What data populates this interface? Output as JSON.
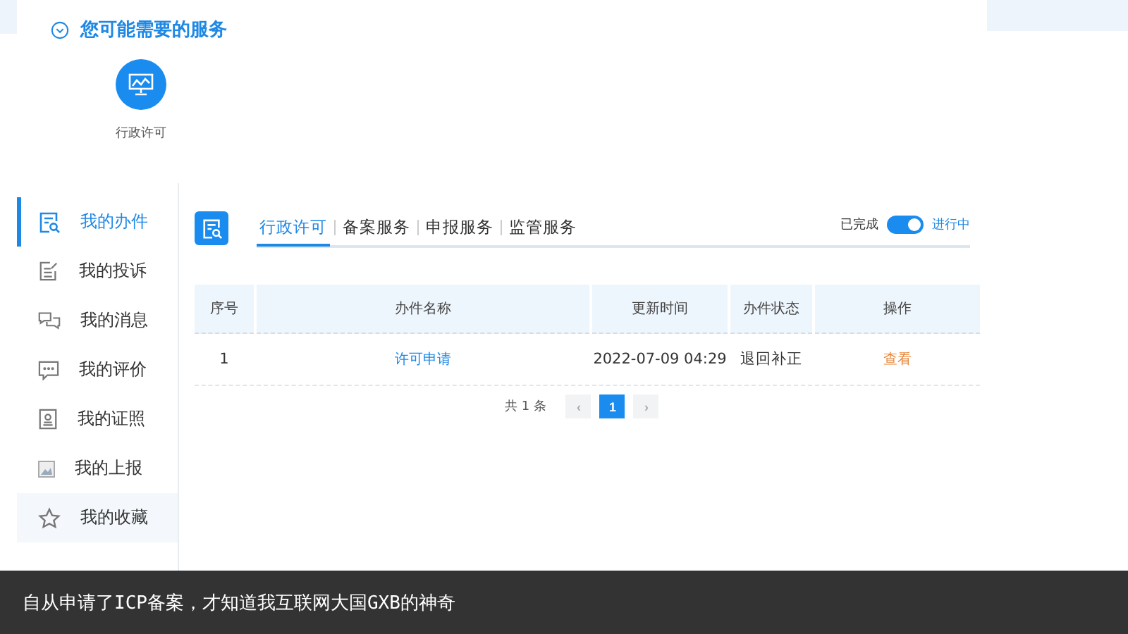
{
  "services": {
    "title": "您可能需要的服务",
    "items": [
      {
        "label": "行政许可"
      }
    ]
  },
  "sidebar": {
    "items": [
      {
        "label": "我的办件",
        "selected": true
      },
      {
        "label": "我的投诉",
        "selected": false
      },
      {
        "label": "我的消息",
        "selected": false
      },
      {
        "label": "我的评价",
        "selected": false
      },
      {
        "label": "我的证照",
        "selected": false
      },
      {
        "label": "我的上报",
        "selected": false
      },
      {
        "label": "我的收藏",
        "selected": false
      }
    ]
  },
  "tabs": [
    {
      "label": "行政许可",
      "selected": true
    },
    {
      "label": "备案服务",
      "selected": false
    },
    {
      "label": "申报服务",
      "selected": false
    },
    {
      "label": "监管服务",
      "selected": false
    }
  ],
  "toggle": {
    "off_label": "已完成",
    "on_label": "进行中",
    "on": true
  },
  "table": {
    "columns": [
      "序号",
      "办件名称",
      "更新时间",
      "办件状态",
      "操作"
    ],
    "rows": [
      {
        "index": "1",
        "name": "许可申请",
        "time": "2022-07-09 04:29",
        "status": "退回补正",
        "action": "查看"
      }
    ]
  },
  "pagination": {
    "total": "共 1 条",
    "prev": "‹",
    "next": "›",
    "pages": [
      {
        "label": "1",
        "selected": true
      }
    ]
  },
  "caption": "自从申请了ICP备案，才知道我互联网大国GXB的神奇"
}
